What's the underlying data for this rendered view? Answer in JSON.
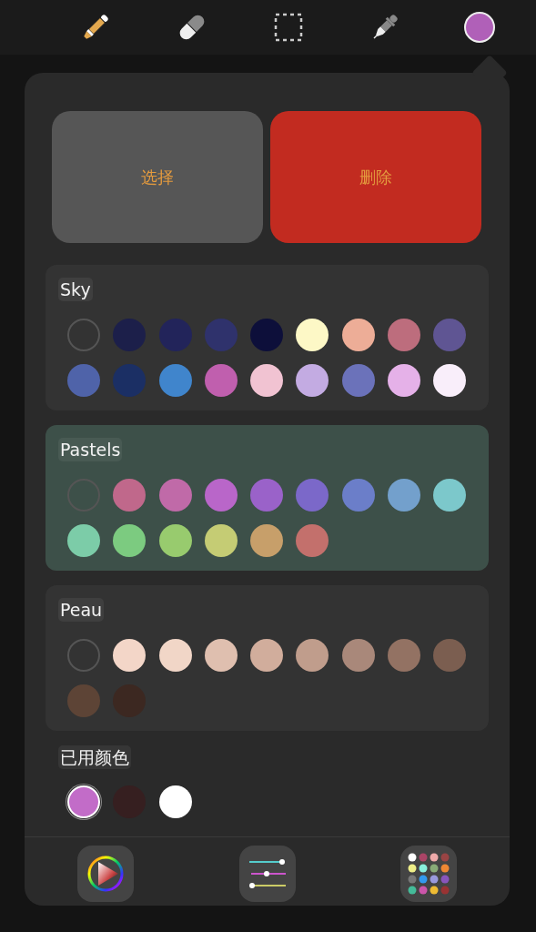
{
  "toolbar": {
    "tools": [
      {
        "kind": "brush",
        "selected": true
      },
      {
        "kind": "eraser",
        "selected": false
      },
      {
        "kind": "selection",
        "selected": false
      },
      {
        "kind": "eyedropper",
        "selected": false
      }
    ],
    "current_swatch": {
      "color": "#b060b8"
    }
  },
  "actions": [
    {
      "label": "选择",
      "kind": "neutral"
    },
    {
      "label": "删除",
      "kind": "danger"
    }
  ],
  "palettes": [
    {
      "name": "Sky",
      "selected": false,
      "swatches": [
        {
          "kind": "empty"
        },
        {
          "color": "#1c1f4a"
        },
        {
          "color": "#22245a"
        },
        {
          "color": "#2f326c"
        },
        {
          "color": "#0d0f3a"
        },
        {
          "color": "#fdf8c6"
        },
        {
          "color": "#edad97"
        },
        {
          "color": "#bd6d7d"
        },
        {
          "color": "#5f5593"
        },
        {
          "color": "#4f63a9"
        },
        {
          "color": "#1b2f64"
        },
        {
          "color": "#4085cc"
        },
        {
          "color": "#c05fae"
        },
        {
          "color": "#f1c3d2"
        },
        {
          "color": "#c3abe2"
        },
        {
          "color": "#6b72ba"
        },
        {
          "color": "#e5b1e8"
        },
        {
          "color": "#f9eefa"
        }
      ]
    },
    {
      "name": "Pastels",
      "selected": true,
      "swatches": [
        {
          "kind": "empty"
        },
        {
          "color": "#c0688b"
        },
        {
          "color": "#c06aa8"
        },
        {
          "color": "#b966c9"
        },
        {
          "color": "#9a62c9"
        },
        {
          "color": "#7b68c9"
        },
        {
          "color": "#6b7ec9"
        },
        {
          "color": "#73a0cc"
        },
        {
          "color": "#7cc8cb"
        },
        {
          "color": "#7ccca8"
        },
        {
          "color": "#7ccb80"
        },
        {
          "color": "#98cb6e"
        },
        {
          "color": "#c5cc74"
        },
        {
          "color": "#c79f6a"
        },
        {
          "color": "#c3706c"
        }
      ]
    },
    {
      "name": "Peau",
      "selected": false,
      "swatches": [
        {
          "kind": "empty"
        },
        {
          "color": "#f3d6c8"
        },
        {
          "color": "#f1d6c7"
        },
        {
          "color": "#dfbfaf"
        },
        {
          "color": "#d1ad9c"
        },
        {
          "color": "#c09d8c"
        },
        {
          "color": "#a9887a"
        },
        {
          "color": "#937263"
        },
        {
          "color": "#7b5e50"
        },
        {
          "color": "#5d4436"
        },
        {
          "color": "#3c2821"
        }
      ]
    }
  ],
  "recent": {
    "title": "已用颜色",
    "swatches": [
      {
        "color": "#c26cc8",
        "selected": true
      },
      {
        "color": "#361f20",
        "selected": false
      },
      {
        "color": "#ffffff",
        "selected": false
      }
    ]
  },
  "bottom_tabs": [
    {
      "kind": "wheel"
    },
    {
      "kind": "sliders"
    },
    {
      "kind": "palettes"
    }
  ]
}
